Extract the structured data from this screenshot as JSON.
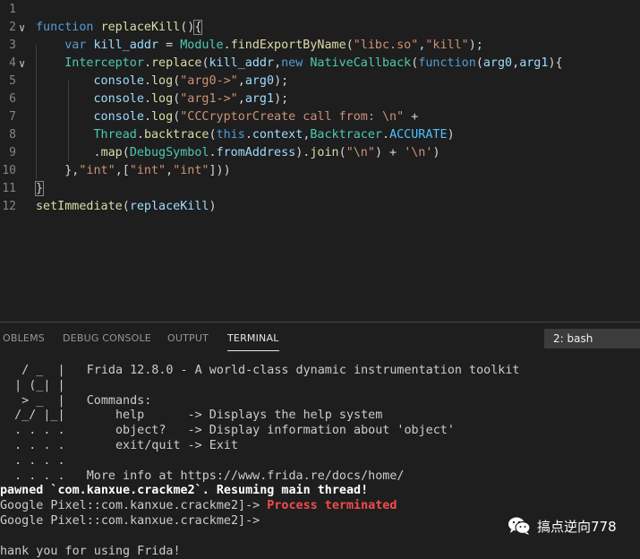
{
  "editor": {
    "line_numbers": [
      "1",
      "2",
      "3",
      "4",
      "5",
      "6",
      "7",
      "8",
      "9",
      "10",
      "11",
      "12"
    ],
    "lines": [
      [],
      [
        [
          "kw",
          "function "
        ],
        [
          "fn",
          "replaceKill"
        ],
        [
          "pl",
          "()"
        ],
        [
          "brace",
          "{"
        ]
      ],
      [
        [
          "pl",
          "    "
        ],
        [
          "kw",
          "var "
        ],
        [
          "var",
          "kill_addr"
        ],
        [
          "pl",
          " = "
        ],
        [
          "cls",
          "Module"
        ],
        [
          "pl",
          "."
        ],
        [
          "fn",
          "findExportByName"
        ],
        [
          "pl",
          "("
        ],
        [
          "str",
          "\"libc.so\""
        ],
        [
          "pl",
          ","
        ],
        [
          "str",
          "\"kill\""
        ],
        [
          "pl",
          ");"
        ]
      ],
      [
        [
          "pl",
          "    "
        ],
        [
          "cls",
          "Interceptor"
        ],
        [
          "pl",
          "."
        ],
        [
          "fn",
          "replace"
        ],
        [
          "pl",
          "("
        ],
        [
          "var",
          "kill_addr"
        ],
        [
          "pl",
          ","
        ],
        [
          "kw",
          "new "
        ],
        [
          "cls",
          "NativeCallback"
        ],
        [
          "pl",
          "("
        ],
        [
          "kw",
          "function"
        ],
        [
          "pl",
          "("
        ],
        [
          "var",
          "arg0"
        ],
        [
          "pl",
          ","
        ],
        [
          "var",
          "arg1"
        ],
        [
          "pl",
          "){"
        ]
      ],
      [
        [
          "pl",
          "        "
        ],
        [
          "var",
          "console"
        ],
        [
          "pl",
          "."
        ],
        [
          "fn",
          "log"
        ],
        [
          "pl",
          "("
        ],
        [
          "str",
          "\"arg0->\""
        ],
        [
          "pl",
          ","
        ],
        [
          "var",
          "arg0"
        ],
        [
          "pl",
          ");"
        ]
      ],
      [
        [
          "pl",
          "        "
        ],
        [
          "var",
          "console"
        ],
        [
          "pl",
          "."
        ],
        [
          "fn",
          "log"
        ],
        [
          "pl",
          "("
        ],
        [
          "str",
          "\"arg1->\""
        ],
        [
          "pl",
          ","
        ],
        [
          "var",
          "arg1"
        ],
        [
          "pl",
          ");"
        ]
      ],
      [
        [
          "pl",
          "        "
        ],
        [
          "var",
          "console"
        ],
        [
          "pl",
          "."
        ],
        [
          "fn",
          "log"
        ],
        [
          "pl",
          "("
        ],
        [
          "str",
          "\"CCCryptorCreate call from: \\n\""
        ],
        [
          "pl",
          " +"
        ]
      ],
      [
        [
          "pl",
          "        "
        ],
        [
          "cls",
          "Thread"
        ],
        [
          "pl",
          "."
        ],
        [
          "fn",
          "backtrace"
        ],
        [
          "pl",
          "("
        ],
        [
          "kw",
          "this"
        ],
        [
          "pl",
          "."
        ],
        [
          "var",
          "context"
        ],
        [
          "pl",
          ","
        ],
        [
          "cls",
          "Backtracer"
        ],
        [
          "pl",
          "."
        ],
        [
          "cst",
          "ACCURATE"
        ],
        [
          "pl",
          ")"
        ]
      ],
      [
        [
          "pl",
          "        ."
        ],
        [
          "fn",
          "map"
        ],
        [
          "pl",
          "("
        ],
        [
          "cls",
          "DebugSymbol"
        ],
        [
          "pl",
          "."
        ],
        [
          "var",
          "fromAddress"
        ],
        [
          "pl",
          ")."
        ],
        [
          "fn",
          "join"
        ],
        [
          "pl",
          "("
        ],
        [
          "str",
          "\"\\n\""
        ],
        [
          "pl",
          ") + "
        ],
        [
          "str",
          "'\\n'"
        ],
        [
          "pl",
          ")"
        ]
      ],
      [
        [
          "pl",
          "    },"
        ],
        [
          "str",
          "\"int\""
        ],
        [
          "pl",
          ",["
        ],
        [
          "str",
          "\"int\""
        ],
        [
          "pl",
          ","
        ],
        [
          "str",
          "\"int\""
        ],
        [
          "pl",
          "]))"
        ]
      ],
      [
        [
          "brace",
          "}"
        ]
      ],
      [
        [
          "fn",
          "setImmediate"
        ],
        [
          "pl",
          "("
        ],
        [
          "var",
          "replaceKill"
        ],
        [
          "pl",
          ")"
        ]
      ]
    ],
    "fold_markers": [
      "",
      "∨",
      "",
      "∨",
      "",
      "",
      "",
      "",
      "",
      "",
      "",
      ""
    ]
  },
  "panel": {
    "tabs": [
      "OBLEMS",
      "DEBUG CONSOLE",
      "OUTPUT",
      "TERMINAL"
    ],
    "active_tab": "TERMINAL",
    "terminal_select": "2: bash",
    "terminal_lines": [
      [
        [
          "n",
          "   / _  |   Frida 12.8.0 - A world-class dynamic instrumentation toolkit"
        ]
      ],
      [
        [
          "n",
          "  | (_| |"
        ]
      ],
      [
        [
          "n",
          "   > _  |   Commands:"
        ]
      ],
      [
        [
          "n",
          "  /_/ |_|       help      -> Displays the help system"
        ]
      ],
      [
        [
          "n",
          "  . . . .       object?   -> Display information about 'object'"
        ]
      ],
      [
        [
          "n",
          "  . . . .       exit/quit -> Exit"
        ]
      ],
      [
        [
          "n",
          "  . . . ."
        ]
      ],
      [
        [
          "n",
          "  . . . .   More info at https://www.frida.re/docs/home/"
        ]
      ],
      [
        [
          "b",
          "pawned `com.kanxue.crackme2`. Resuming main thread!"
        ]
      ],
      [
        [
          "n",
          "Google Pixel::com.kanxue.crackme2]-> "
        ],
        [
          "r",
          "Process terminated"
        ]
      ],
      [
        [
          "n",
          "Google Pixel::com.kanxue.crackme2]->"
        ]
      ],
      [
        [
          "n",
          ""
        ]
      ],
      [
        [
          "n",
          "hank you for using Frida!"
        ]
      ]
    ]
  },
  "watermark": {
    "icon": "wechat-icon",
    "text": "搞点逆向778"
  }
}
